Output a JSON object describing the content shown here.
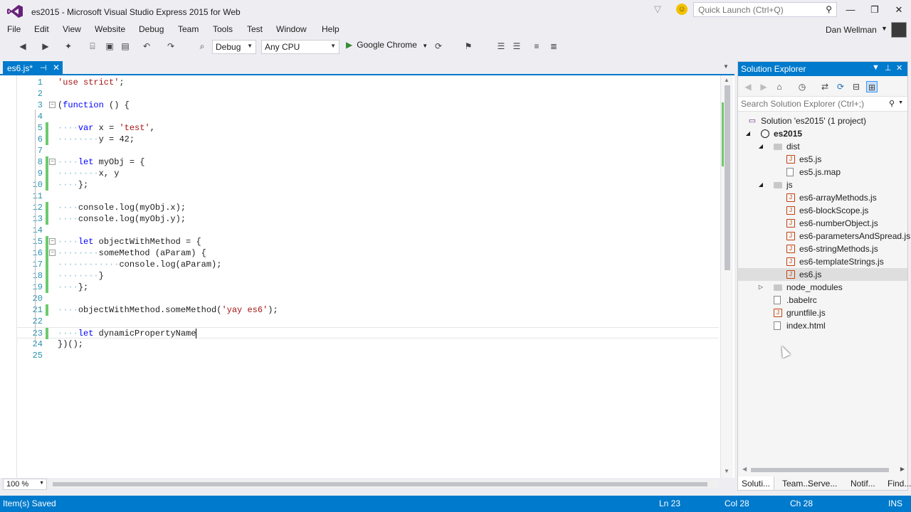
{
  "window": {
    "title": "es2015 - Microsoft Visual Studio Express 2015 for Web",
    "quick_launch_placeholder": "Quick Launch (Ctrl+Q)",
    "user": "Dan Wellman",
    "controls": {
      "minimize": "—",
      "restore": "❐",
      "close": "✕"
    }
  },
  "menu": [
    "File",
    "Edit",
    "View",
    "Website",
    "Debug",
    "Team",
    "Tools",
    "Test",
    "Window",
    "Help"
  ],
  "toolbar": {
    "configuration": "Debug",
    "platform": "Any CPU",
    "run_target": "Google Chrome"
  },
  "editor": {
    "tab_label": "es6.js*",
    "zoom": "100 %",
    "lines": [
      {
        "n": "1",
        "text": "'use strict';"
      },
      {
        "n": "2",
        "text": ""
      },
      {
        "n": "3",
        "text": "(function () {"
      },
      {
        "n": "4",
        "text": ""
      },
      {
        "n": "5",
        "text": "    var x = 'test',"
      },
      {
        "n": "6",
        "text": "        y = 42;"
      },
      {
        "n": "7",
        "text": ""
      },
      {
        "n": "8",
        "text": "    let myObj = {"
      },
      {
        "n": "9",
        "text": "        x, y"
      },
      {
        "n": "10",
        "text": "    };"
      },
      {
        "n": "11",
        "text": ""
      },
      {
        "n": "12",
        "text": "    console.log(myObj.x);"
      },
      {
        "n": "13",
        "text": "    console.log(myObj.y);"
      },
      {
        "n": "14",
        "text": ""
      },
      {
        "n": "15",
        "text": "    let objectWithMethod = {"
      },
      {
        "n": "16",
        "text": "        someMethod (aParam) {"
      },
      {
        "n": "17",
        "text": "            console.log(aParam);"
      },
      {
        "n": "18",
        "text": "        }"
      },
      {
        "n": "19",
        "text": "    };"
      },
      {
        "n": "20",
        "text": ""
      },
      {
        "n": "21",
        "text": "    objectWithMethod.someMethod('yay es6');"
      },
      {
        "n": "22",
        "text": ""
      },
      {
        "n": "23",
        "text": "    let dynamicPropertyName"
      },
      {
        "n": "24",
        "text": "})();"
      },
      {
        "n": "25",
        "text": ""
      }
    ]
  },
  "solution_explorer": {
    "title": "Solution Explorer",
    "search_placeholder": "Search Solution Explorer (Ctrl+;)",
    "items": [
      {
        "label": "Solution 'es2015' (1 project)"
      },
      {
        "label": "es2015"
      },
      {
        "label": "dist"
      },
      {
        "label": "es5.js"
      },
      {
        "label": "es5.js.map"
      },
      {
        "label": "js"
      },
      {
        "label": "es6-arrayMethods.js"
      },
      {
        "label": "es6-blockScope.js"
      },
      {
        "label": "es6-numberObject.js"
      },
      {
        "label": "es6-parametersAndSpread.js"
      },
      {
        "label": "es6-stringMethods.js"
      },
      {
        "label": "es6-templateStrings.js"
      },
      {
        "label": "es6.js"
      },
      {
        "label": "node_modules"
      },
      {
        "label": ".babelrc"
      },
      {
        "label": "gruntfile.js"
      },
      {
        "label": "index.html"
      }
    ],
    "tabs": [
      "Soluti...",
      "Team...",
      "Serve...",
      "Notif...",
      "Find..."
    ]
  },
  "status": {
    "message": "Item(s) Saved",
    "line": "Ln 23",
    "col": "Col 28",
    "ch": "Ch 28",
    "mode": "INS"
  },
  "colors": {
    "accent": "#007acc",
    "keyword": "#0000ff",
    "string": "#a31515",
    "line_number": "#2b91af",
    "saved_change": "#6cca6c"
  }
}
